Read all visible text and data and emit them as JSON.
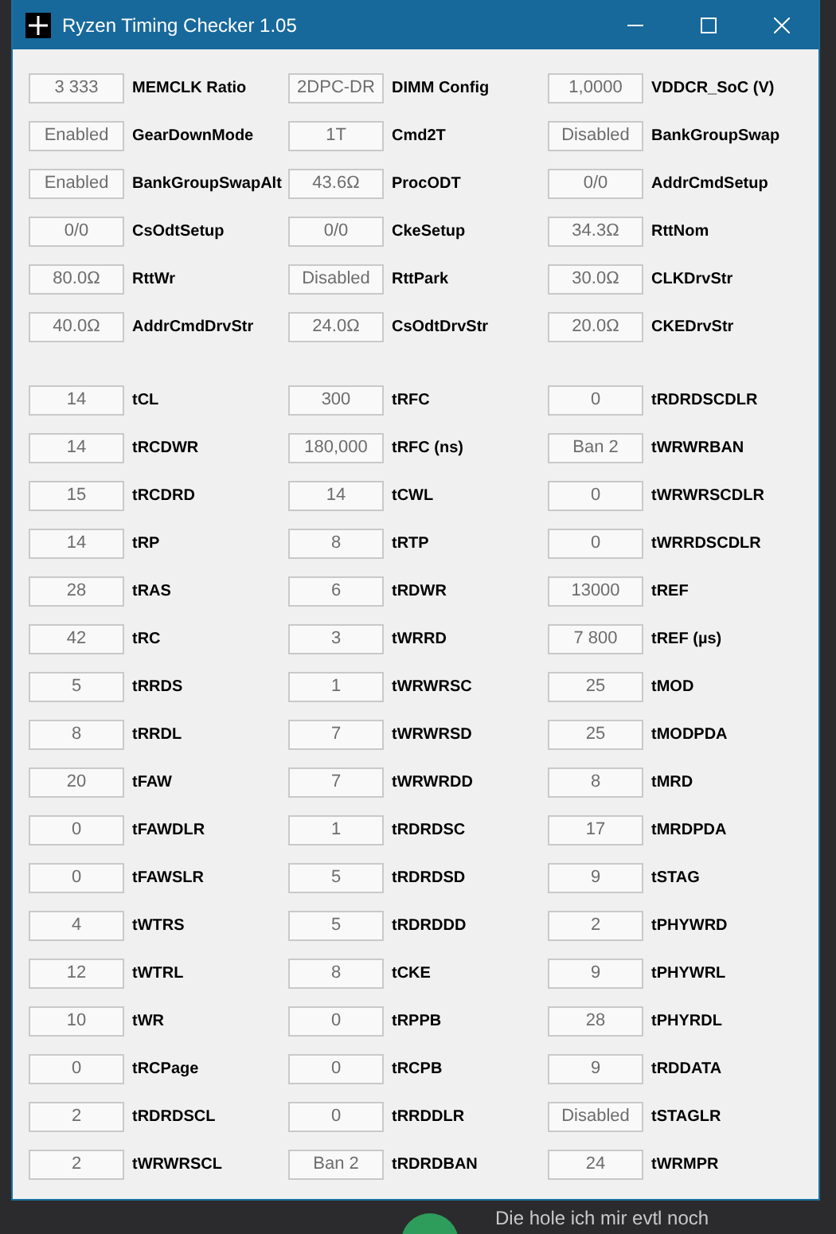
{
  "window": {
    "title": "Ryzen Timing Checker 1.05"
  },
  "sections": [
    {
      "fields": [
        {
          "reading": "3 333",
          "name": "MEMCLK Ratio"
        },
        {
          "reading": "2DPC-DR",
          "name": "DIMM Config"
        },
        {
          "reading": "1,0000",
          "name": "VDDCR_SoC (V)"
        },
        {
          "reading": "Enabled",
          "name": "GearDownMode"
        },
        {
          "reading": "1T",
          "name": "Cmd2T"
        },
        {
          "reading": "Disabled",
          "name": "BankGroupSwap"
        },
        {
          "reading": "Enabled",
          "name": "BankGroupSwapAlt"
        },
        {
          "reading": "43.6Ω",
          "name": "ProcODT"
        },
        {
          "reading": "0/0",
          "name": "AddrCmdSetup"
        },
        {
          "reading": "0/0",
          "name": "CsOdtSetup"
        },
        {
          "reading": "0/0",
          "name": "CkeSetup"
        },
        {
          "reading": "34.3Ω",
          "name": "RttNom"
        },
        {
          "reading": "80.0Ω",
          "name": "RttWr"
        },
        {
          "reading": "Disabled",
          "name": "RttPark"
        },
        {
          "reading": "30.0Ω",
          "name": "CLKDrvStr"
        },
        {
          "reading": "40.0Ω",
          "name": "AddrCmdDrvStr"
        },
        {
          "reading": "24.0Ω",
          "name": "CsOdtDrvStr"
        },
        {
          "reading": "20.0Ω",
          "name": "CKEDrvStr"
        }
      ]
    },
    {
      "fields": [
        {
          "reading": "14",
          "name": "tCL"
        },
        {
          "reading": "300",
          "name": "tRFC"
        },
        {
          "reading": "0",
          "name": "tRDRDSCDLR"
        },
        {
          "reading": "14",
          "name": "tRCDWR"
        },
        {
          "reading": "180,000",
          "name": "tRFC (ns)"
        },
        {
          "reading": "Ban 2",
          "name": "tWRWRBAN"
        },
        {
          "reading": "15",
          "name": "tRCDRD"
        },
        {
          "reading": "14",
          "name": "tCWL"
        },
        {
          "reading": "0",
          "name": "tWRWRSCDLR"
        },
        {
          "reading": "14",
          "name": "tRP"
        },
        {
          "reading": "8",
          "name": "tRTP"
        },
        {
          "reading": "0",
          "name": "tWRRDSCDLR"
        },
        {
          "reading": "28",
          "name": "tRAS"
        },
        {
          "reading": "6",
          "name": "tRDWR"
        },
        {
          "reading": "13000",
          "name": "tREF"
        },
        {
          "reading": "42",
          "name": "tRC"
        },
        {
          "reading": "3",
          "name": "tWRRD"
        },
        {
          "reading": "7 800",
          "name": "tREF (µs)"
        },
        {
          "reading": "5",
          "name": "tRRDS"
        },
        {
          "reading": "1",
          "name": "tWRWRSC"
        },
        {
          "reading": "25",
          "name": "tMOD"
        },
        {
          "reading": "8",
          "name": "tRRDL"
        },
        {
          "reading": "7",
          "name": "tWRWRSD"
        },
        {
          "reading": "25",
          "name": "tMODPDA"
        },
        {
          "reading": "20",
          "name": "tFAW"
        },
        {
          "reading": "7",
          "name": "tWRWRDD"
        },
        {
          "reading": "8",
          "name": "tMRD"
        },
        {
          "reading": "0",
          "name": "tFAWDLR"
        },
        {
          "reading": "1",
          "name": "tRDRDSC"
        },
        {
          "reading": "17",
          "name": "tMRDPDA"
        },
        {
          "reading": "0",
          "name": "tFAWSLR"
        },
        {
          "reading": "5",
          "name": "tRDRDSD"
        },
        {
          "reading": "9",
          "name": "tSTAG"
        },
        {
          "reading": "4",
          "name": "tWTRS"
        },
        {
          "reading": "5",
          "name": "tRDRDDD"
        },
        {
          "reading": "2",
          "name": "tPHYWRD"
        },
        {
          "reading": "12",
          "name": "tWTRL"
        },
        {
          "reading": "8",
          "name": "tCKE"
        },
        {
          "reading": "9",
          "name": "tPHYWRL"
        },
        {
          "reading": "10",
          "name": "tWR"
        },
        {
          "reading": "0",
          "name": "tRPPB"
        },
        {
          "reading": "28",
          "name": "tPHYRDL"
        },
        {
          "reading": "0",
          "name": "tRCPage"
        },
        {
          "reading": "0",
          "name": "tRCPB"
        },
        {
          "reading": "9",
          "name": "tRDDATA"
        },
        {
          "reading": "2",
          "name": "tRDRDSCL"
        },
        {
          "reading": "0",
          "name": "tRRDDLR"
        },
        {
          "reading": "Disabled",
          "name": "tSTAGLR"
        },
        {
          "reading": "2",
          "name": "tWRWRSCL"
        },
        {
          "reading": "Ban 2",
          "name": "tRDRDBAN"
        },
        {
          "reading": "24",
          "name": "tWRMPR"
        }
      ]
    }
  ],
  "background_text": "Die hole ich mir evtl noch"
}
